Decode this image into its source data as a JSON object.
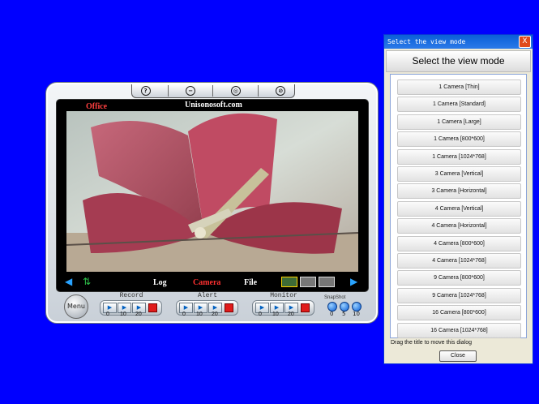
{
  "camera_window": {
    "location_label": "Office",
    "site_label": "Unisonosoft.com",
    "tabs": [
      {
        "label": "Log",
        "active": false
      },
      {
        "label": "Camera",
        "active": true
      },
      {
        "label": "File",
        "active": false
      }
    ],
    "menu_label": "Menu",
    "groups": [
      {
        "label": "Record",
        "ticks": [
          "0",
          "10",
          "20"
        ]
      },
      {
        "label": "Alert",
        "ticks": [
          "0",
          "10",
          "20"
        ]
      },
      {
        "label": "Monitor",
        "ticks": [
          "0",
          "10",
          "20"
        ]
      }
    ],
    "snapshot": {
      "label": "SnapShot",
      "ticks": [
        "0",
        "5",
        "10"
      ]
    }
  },
  "dialog": {
    "title": "Select the view mode",
    "heading": "Select the view mode",
    "close_x": "X",
    "options": [
      "1 Camera [Thin]",
      "1 Camera [Standard]",
      "1 Camera [Large]",
      "1 Camera [800*600]",
      "1 Camera [1024*768]",
      "3 Camera [Vertical]",
      "3 Camera [Horizontal]",
      "4 Camera [Vertical]",
      "4 Camera [Horizontal]",
      "4 Camera [800*600]",
      "4 Camera [1024*768]",
      "9 Camera [800*600]",
      "9 Camera [1024*768]",
      "16 Camera [800*600]",
      "16 Camera [1024*768]"
    ],
    "hint": "Drag the title to move this dialog",
    "close_button": "Close"
  },
  "colors": {
    "desktop": "#0000ff",
    "active_tab": "#ff3030",
    "title_bar": "#0a5fd7"
  }
}
